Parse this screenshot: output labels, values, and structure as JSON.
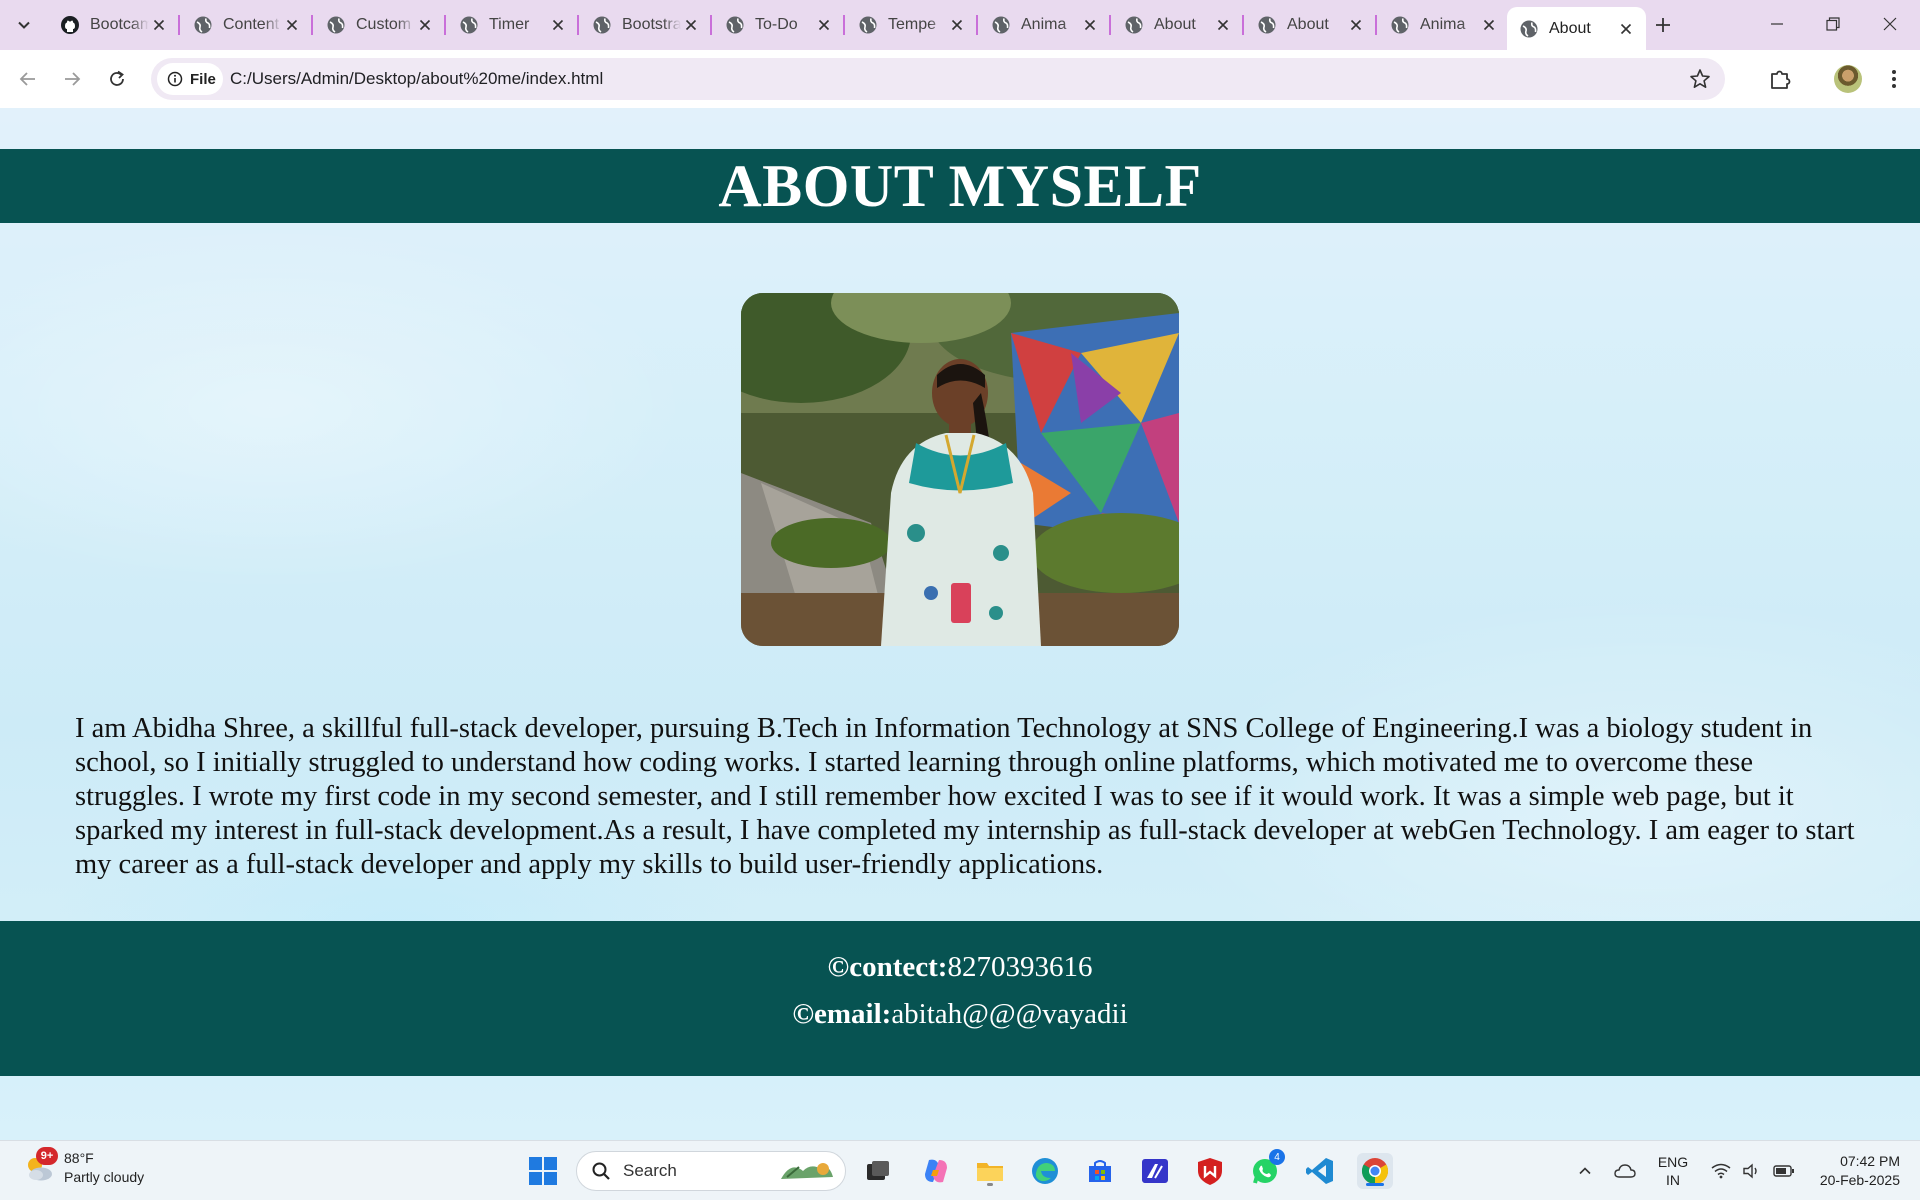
{
  "browser": {
    "tabs": [
      {
        "title": "Bootcamp",
        "favicon": "github-icon"
      },
      {
        "title": "Content",
        "favicon": "globe-icon"
      },
      {
        "title": "Custom",
        "favicon": "globe-icon"
      },
      {
        "title": "Timer",
        "favicon": "globe-icon"
      },
      {
        "title": "Bootstrap",
        "favicon": "globe-icon"
      },
      {
        "title": "To-Do",
        "favicon": "globe-icon"
      },
      {
        "title": "Tempe",
        "favicon": "globe-icon"
      },
      {
        "title": "Anima",
        "favicon": "globe-icon"
      },
      {
        "title": "About",
        "favicon": "globe-icon"
      },
      {
        "title": "About",
        "favicon": "globe-icon"
      },
      {
        "title": "Anima",
        "favicon": "globe-icon"
      },
      {
        "title": "About",
        "favicon": "globe-icon",
        "active": true
      }
    ],
    "site_chip_label": "File",
    "url": "C:/Users/Admin/Desktop/about%20me/index.html",
    "accent_color": "#c96fd9"
  },
  "page": {
    "header_title": "ABOUT MYSELF",
    "header_color": "#075352",
    "bio": "I am Abidha Shree, a skillful full-stack developer, pursuing B.Tech in Information Technology at SNS College of Engineering.I was a biology student in school, so I initially struggled to understand how coding works. I started learning through online platforms, which motivated me to overcome these struggles. I wrote my first code in my second semester, and I still remember how excited I was to see if it would work. It was a simple web page, but it sparked my interest in full-stack development.As a result, I have completed my internship as full-stack developer at webGen Technology. I am eager to start my career as a full-stack developer and apply my skills to build user-friendly applications.",
    "footer": {
      "contact_label": "©contect:",
      "contact_value": "8270393616",
      "email_label": "©email:",
      "email_value": "abitah@@@vayadii"
    }
  },
  "taskbar": {
    "weather_badge": "9+",
    "weather_temp": "88°F",
    "weather_desc": "Partly cloudy",
    "search_label": "Search",
    "whatsapp_badge": "4",
    "lang_line1": "ENG",
    "lang_line2": "IN",
    "time": "07:42 PM",
    "date": "20-Feb-2025"
  }
}
